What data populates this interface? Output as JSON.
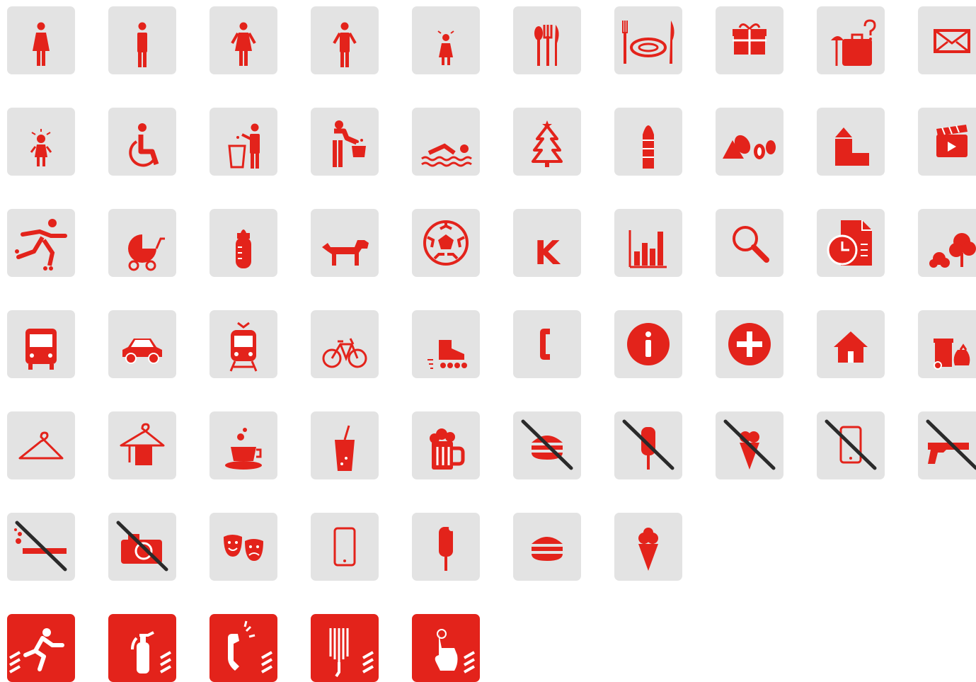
{
  "colors": {
    "tile_bg": "#e3e3e3",
    "icon": "#e3231b",
    "strike": "#2a2a2a",
    "emergency_bg": "#e3231b",
    "emergency_fg": "#ffffff"
  },
  "rows": [
    [
      "woman-icon",
      "man-icon",
      "woman-standing-icon",
      "man-standing-icon",
      "girl-icon",
      "cutlery-icon",
      "plate-cutlery-icon",
      "gift-icon",
      "lost-and-found-icon",
      "mail-icon"
    ],
    [
      "child-icon",
      "wheelchair-icon",
      "trash-disposal-icon",
      "feed-animals-icon",
      "swimming-icon",
      "christmas-tree-icon",
      "tower-icon",
      "shapes-icon",
      "building-blocks-icon",
      "clapperboard-icon"
    ],
    [
      "roller-skater-icon",
      "stroller-icon",
      "baby-bottle-icon",
      "dog-icon",
      "soccer-ball-icon",
      "k-logo-icon",
      "bar-chart-icon",
      "search-icon",
      "schedule-icon",
      "trees-icon"
    ],
    [
      "bus-icon",
      "car-icon",
      "tram-icon",
      "bicycle-icon",
      "inline-skate-icon",
      "telephone-icon",
      "info-icon",
      "first-aid-icon",
      "home-icon",
      "waste-bin-icon"
    ],
    [
      "hanger-icon",
      "towel-hanger-icon",
      "coffee-cup-icon",
      "soft-drink-icon",
      "beer-mug-icon",
      "no-burger-icon",
      "no-popsicle-icon",
      "no-ice-cream-icon",
      "no-phone-icon",
      "no-gun-icon"
    ],
    [
      "no-smoking-icon",
      "no-camera-icon",
      "theater-masks-icon",
      "smartphone-icon",
      "popsicle-icon",
      "burger-icon",
      "ice-cream-icon"
    ],
    [
      "emergency-exit-icon",
      "fire-extinguisher-icon",
      "emergency-phone-icon",
      "fire-hose-icon",
      "alarm-button-icon"
    ]
  ],
  "k_logo_text": "K"
}
